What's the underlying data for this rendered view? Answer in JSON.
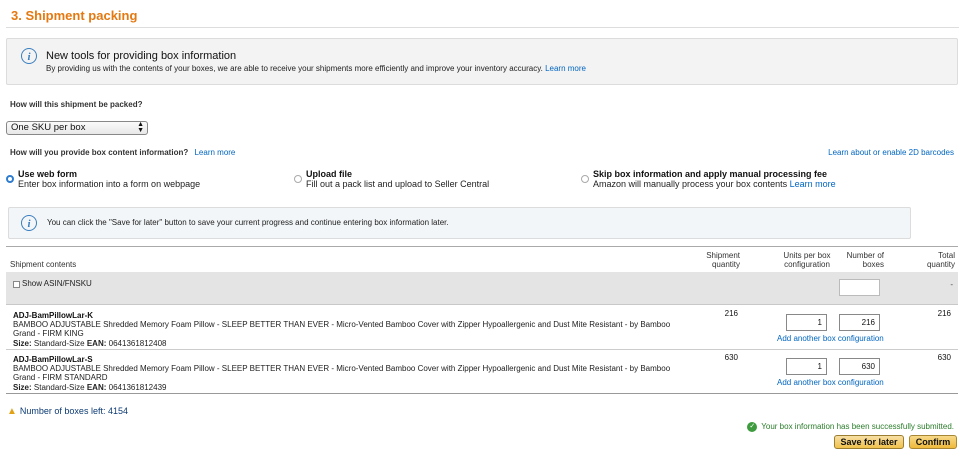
{
  "section": {
    "title": "3. Shipment packing"
  },
  "info_banner": {
    "title": "New tools for providing box information",
    "text": "By providing us with the contents of your boxes, we are able to receive your shipments more efficiently and improve your inventory accuracy.",
    "link": "Learn more"
  },
  "packing": {
    "question": "How will this shipment be packed?",
    "selected": "One SKU per box"
  },
  "box_content": {
    "question": "How will you provide box content information?",
    "learn_more": "Learn more",
    "barcodes_link": "Learn about or enable 2D barcodes",
    "options": [
      {
        "label": "Use web form",
        "desc": "Enter box information into a form on webpage",
        "selected": true
      },
      {
        "label": "Upload file",
        "desc": "Fill out a pack list and upload to Seller Central",
        "selected": false
      },
      {
        "label": "Skip box information and apply manual processing fee",
        "desc": "Amazon will manually process your box contents",
        "link": "Learn more",
        "selected": false
      }
    ]
  },
  "save_note": "You can click the \"Save for later\" button to save your current progress and continue entering box information later.",
  "table": {
    "headers": {
      "contents": "Shipment contents",
      "shipment_qty_1": "Shipment",
      "shipment_qty_2": "quantity",
      "units_1": "Units per box",
      "units_2": "configuration",
      "boxes_1": "Number of",
      "boxes_2": "boxes",
      "total_1": "Total",
      "total_2": "quantity"
    },
    "show_asin": "Show ASIN/FNSKU",
    "summary_total": "-",
    "rows": [
      {
        "sku": "ADJ-BamPillowLar-K",
        "desc": "BAMBOO ADJUSTABLE Shredded Memory Foam Pillow - SLEEP BETTER THAN EVER - Micro-Vented Bamboo Cover with Zipper Hypoallergenic and Dust Mite Resistant - by Bamboo Grand - FIRM KING",
        "size_label": "Size:",
        "size": "Standard-Size",
        "ean_label": "EAN:",
        "ean": "0641361812408",
        "shipment_qty": "216",
        "units_per_box": "1",
        "boxes": "216",
        "add_config": "Add another box configuration",
        "total": "216"
      },
      {
        "sku": "ADJ-BamPillowLar-S",
        "desc": "BAMBOO ADJUSTABLE Shredded Memory Foam Pillow - SLEEP BETTER THAN EVER - Micro-Vented Bamboo Cover with Zipper Hypoallergenic and Dust Mite Resistant - by Bamboo Grand - FIRM STANDARD",
        "size_label": "Size:",
        "size": "Standard-Size",
        "ean_label": "EAN:",
        "ean": "0641361812439",
        "shipment_qty": "630",
        "units_per_box": "1",
        "boxes": "630",
        "add_config": "Add another box configuration",
        "total": "630"
      }
    ]
  },
  "boxes_left": "Number of boxes left: 4154",
  "success_msg": "Your box information has been successfully submitted.",
  "buttons": {
    "save": "Save for later",
    "confirm": "Confirm"
  }
}
